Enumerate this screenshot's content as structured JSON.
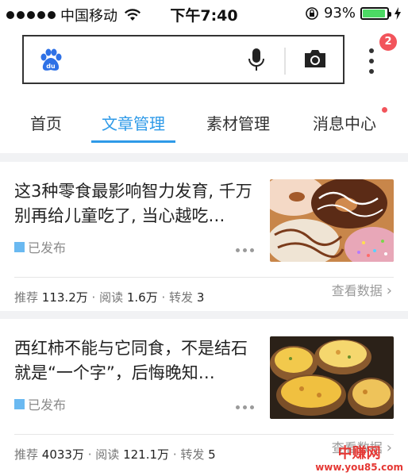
{
  "status_bar": {
    "carrier": "中国移动",
    "time": "下午7:40",
    "battery_percent": "93%",
    "battery_level": 0.93
  },
  "header": {
    "notification_count": "2",
    "icons": [
      "baidu-paw-icon",
      "microphone-icon",
      "camera-icon",
      "more-vertical-icon"
    ]
  },
  "tabs": [
    {
      "label": "首页",
      "active": false
    },
    {
      "label": "文章管理",
      "active": true
    },
    {
      "label": "素材管理",
      "active": false
    },
    {
      "label": "消息中心",
      "active": false,
      "has_dot": true
    }
  ],
  "articles": [
    {
      "title": "这3种零食最影响智力发育, 千万别再给儿童吃了, 当心越吃…",
      "status": "已发布",
      "view_data": "查看数据",
      "recommend_label": "推荐",
      "recommend": "113.2万",
      "read_label": "阅读",
      "read": "1.6万",
      "share_label": "转发",
      "share": "3",
      "image": "donuts"
    },
    {
      "title": "西红柿不能与它同食，不是结石就是“一个字”，后悔晚知…",
      "status": "已发布",
      "view_data": "查看数据",
      "recommend_label": "推荐",
      "recommend": "4033万",
      "read_label": "阅读",
      "read": "121.1万",
      "share_label": "转发",
      "share": "5",
      "image": "baked-potatoes"
    }
  ],
  "watermark": {
    "brand": "中赚网",
    "url": "www.you85.com"
  },
  "colors": {
    "accent": "#2e9ae8",
    "badge": "#f2545b",
    "battery": "#4cd964",
    "status_square": "#6ab9f1"
  }
}
